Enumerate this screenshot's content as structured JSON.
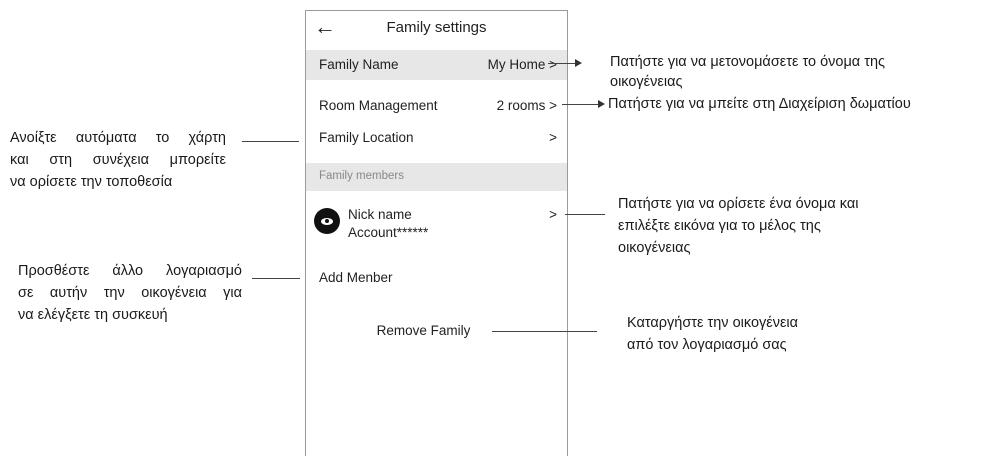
{
  "screen": {
    "title": "Family settings",
    "rows": {
      "family_name": {
        "label": "Family Name",
        "value": "My Home >"
      },
      "room_management": {
        "label": "Room Management",
        "value": "2 rooms >"
      },
      "family_location": {
        "label": "Family Location",
        "value": ">"
      }
    },
    "section_label": "Family members",
    "member": {
      "nick_name": "Nick name",
      "account": "Account******",
      "chevron": ">"
    },
    "add_member": "Add Menber",
    "remove_family": "Remove Family"
  },
  "annotations": {
    "rename_line1": "Πατήστε για να μετονομάσετε το όνομα της",
    "rename_line2": "οικογένειας",
    "rooms": "Πατήστε για να μπείτε στη Διαχείριση δωματίου",
    "location_line1": "Ανοίξτε αυτόματα το χάρτη",
    "location_line2": "και στη συνέχεια μπορείτε",
    "location_line3": "να ορίσετε την τοποθεσία",
    "member_line1": "Πατήστε για να ορίσετε ένα όνομα και",
    "member_line2": "επιλέξτε εικόνα για το μέλος της",
    "member_line3": "οικογένειας",
    "add_line1": "Προσθέστε άλλο λογαριασμό",
    "add_line2": "σε αυτήν την οικογένεια για",
    "add_line3": "να ελέγξετε τη συσκευή",
    "remove_line1": "Καταργήστε την οικογένεια",
    "remove_line2": "από τον λογαριασμό σας"
  },
  "colors": {
    "row_highlight": "#e7e7e7",
    "section_text": "#888888"
  },
  "icons": {
    "back": "arrow-left-icon",
    "avatar": "eye-avatar-icon"
  }
}
